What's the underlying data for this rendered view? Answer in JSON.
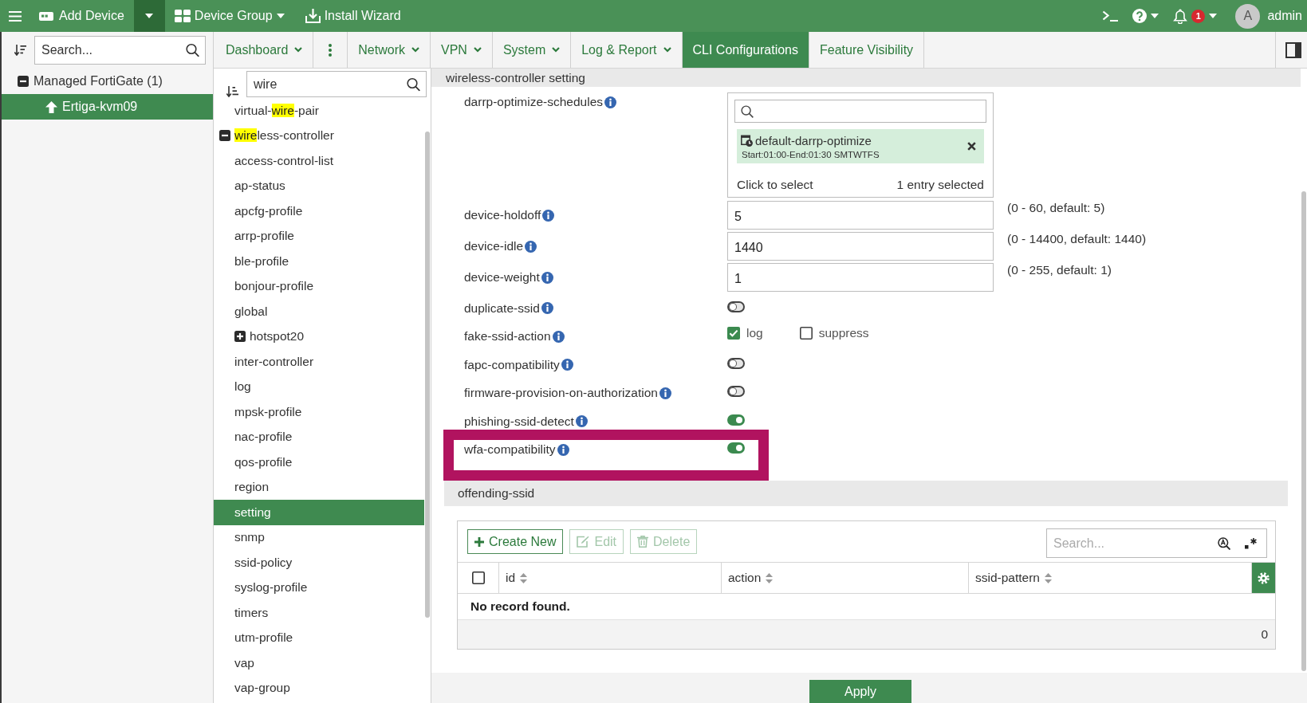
{
  "top_bar": {
    "add_device": {
      "label": "Add Device"
    },
    "device_group": {
      "label": "Device Group"
    },
    "install_wizard": {
      "label": "Install Wizard"
    },
    "notifications": {
      "count": "1"
    },
    "user": {
      "initial": "A",
      "name": "admin"
    }
  },
  "tabs": [
    {
      "kind": "menu",
      "label": "Dashboard",
      "caret": true,
      "selected": false
    },
    {
      "kind": "more",
      "selected": false
    },
    {
      "kind": "menu",
      "label": "Network",
      "caret": true,
      "selected": false
    },
    {
      "kind": "menu",
      "label": "VPN",
      "caret": true,
      "selected": false
    },
    {
      "kind": "menu",
      "label": "System",
      "caret": true,
      "selected": false
    },
    {
      "kind": "menu",
      "label": "Log & Report",
      "caret": true,
      "selected": false
    },
    {
      "kind": "menu",
      "label": "CLI Configurations",
      "caret": false,
      "selected": true
    },
    {
      "kind": "menu",
      "label": "Feature Visibility",
      "caret": false,
      "selected": false
    }
  ],
  "device_panel": {
    "search": {
      "placeholder": "Search..."
    },
    "tree": [
      {
        "kind": "folder",
        "label": "Managed FortiGate (1)",
        "expanded": true,
        "selected": false,
        "children": [
          {
            "kind": "device",
            "label": "Ertiga-kvm09",
            "selected": true
          }
        ]
      }
    ]
  },
  "config_panel": {
    "search": {
      "value": "wire"
    },
    "tree": [
      {
        "kind": "leaf",
        "parts": [
          {
            "text": "virtual-",
            "match": false
          },
          {
            "text": "wire",
            "match": true
          },
          {
            "text": "-pair",
            "match": false
          }
        ],
        "selected": false
      },
      {
        "kind": "folder",
        "parts": [
          {
            "text": "wire",
            "match": true
          },
          {
            "text": "less-controller",
            "match": false
          }
        ],
        "expanded": true,
        "selected": false,
        "children": [
          {
            "kind": "leaf",
            "label": "access-control-list",
            "selected": false
          },
          {
            "kind": "leaf",
            "label": "ap-status",
            "selected": false
          },
          {
            "kind": "leaf",
            "label": "apcfg-profile",
            "selected": false
          },
          {
            "kind": "leaf",
            "label": "arrp-profile",
            "selected": false
          },
          {
            "kind": "leaf",
            "label": "ble-profile",
            "selected": false
          },
          {
            "kind": "leaf",
            "label": "bonjour-profile",
            "selected": false
          },
          {
            "kind": "leaf",
            "label": "global",
            "selected": false
          },
          {
            "kind": "folder",
            "label": "hotspot20",
            "expanded": false,
            "selected": false
          },
          {
            "kind": "leaf",
            "label": "inter-controller",
            "selected": false
          },
          {
            "kind": "leaf",
            "label": "log",
            "selected": false
          },
          {
            "kind": "leaf",
            "label": "mpsk-profile",
            "selected": false
          },
          {
            "kind": "leaf",
            "label": "nac-profile",
            "selected": false
          },
          {
            "kind": "leaf",
            "label": "qos-profile",
            "selected": false
          },
          {
            "kind": "leaf",
            "label": "region",
            "selected": false
          },
          {
            "kind": "leaf",
            "label": "setting",
            "selected": true
          },
          {
            "kind": "leaf",
            "label": "snmp",
            "selected": false
          },
          {
            "kind": "leaf",
            "label": "ssid-policy",
            "selected": false
          },
          {
            "kind": "leaf",
            "label": "syslog-profile",
            "selected": false
          },
          {
            "kind": "leaf",
            "label": "timers",
            "selected": false
          },
          {
            "kind": "leaf",
            "label": "utm-profile",
            "selected": false
          },
          {
            "kind": "leaf",
            "label": "vap",
            "selected": false
          },
          {
            "kind": "leaf",
            "label": "vap-group",
            "selected": false
          }
        ]
      }
    ]
  },
  "section": {
    "title": "wireless-controller setting",
    "fields": [
      {
        "kind": "multiselect",
        "label": "darrp-optimize-schedules",
        "entries": [
          {
            "name": "default-darrp-optimize",
            "detail": "Start:01:00-End:01:30 SMTWTFS"
          }
        ],
        "prompt": "Click to select",
        "count": "1 entry selected",
        "highlighted": false
      },
      {
        "kind": "number",
        "label": "device-holdoff",
        "value": "5",
        "hint": "(0 - 60, default: 5)",
        "highlighted": false
      },
      {
        "kind": "number",
        "label": "device-idle",
        "value": "1440",
        "hint": "(0 - 14400, default: 1440)",
        "highlighted": false
      },
      {
        "kind": "number",
        "label": "device-weight",
        "value": "1",
        "hint": "(0 - 255, default: 1)",
        "highlighted": false
      },
      {
        "kind": "toggle",
        "label": "duplicate-ssid",
        "on": false,
        "highlighted": false
      },
      {
        "kind": "checkboxes",
        "label": "fake-ssid-action",
        "options": [
          {
            "label": "log",
            "checked": true
          },
          {
            "label": "suppress",
            "checked": false
          }
        ],
        "highlighted": false
      },
      {
        "kind": "toggle",
        "label": "fapc-compatibility",
        "on": false,
        "highlighted": false
      },
      {
        "kind": "toggle",
        "label": "firmware-provision-on-authorization",
        "on": false,
        "highlighted": false
      },
      {
        "kind": "toggle",
        "label": "phishing-ssid-detect",
        "on": true,
        "highlighted": false
      },
      {
        "kind": "toggle",
        "label": "wfa-compatibility",
        "on": true,
        "highlighted": true
      }
    ]
  },
  "offending_ssid": {
    "title": "offending-ssid",
    "buttons": [
      {
        "kind": "create",
        "label": "Create New",
        "disabled": false
      },
      {
        "kind": "edit",
        "label": "Edit",
        "disabled": true
      },
      {
        "kind": "delete",
        "label": "Delete",
        "disabled": true
      }
    ],
    "search": {
      "placeholder": "Search..."
    },
    "table": {
      "select_all": {
        "checked": false
      },
      "columns": [
        {
          "label": "id"
        },
        {
          "label": "action"
        },
        {
          "label": "ssid-pattern"
        }
      ],
      "empty_message": "No record found.",
      "total": "0"
    }
  },
  "apply_button": {
    "label": "Apply"
  }
}
